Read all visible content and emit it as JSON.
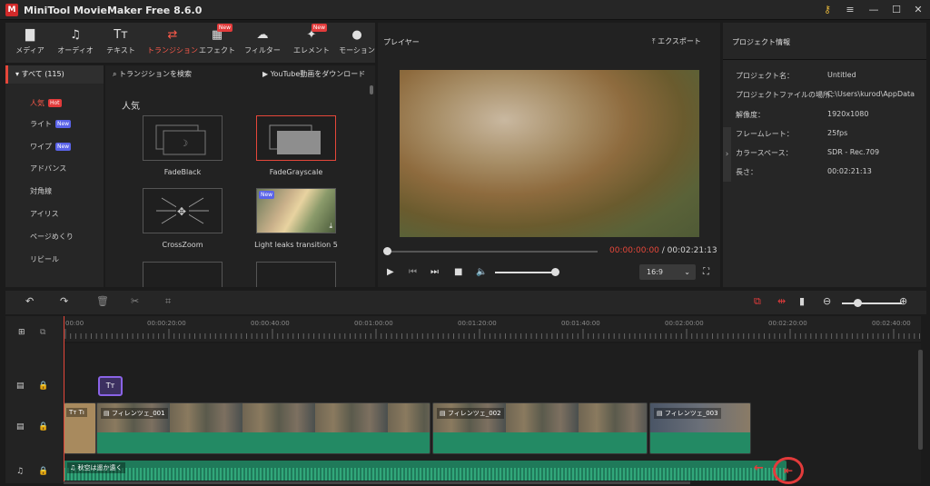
{
  "app": {
    "logo": "M",
    "title": "MiniTool MovieMaker Free 8.6.0"
  },
  "window_icons": [
    "key-icon",
    "menu-icon",
    "minimize-icon",
    "maximize-icon",
    "close-icon"
  ],
  "toolbar": [
    {
      "label": "メディア",
      "icon": "▇",
      "badge": ""
    },
    {
      "label": "オーディオ",
      "icon": "♫",
      "badge": ""
    },
    {
      "label": "テキスト",
      "icon": "Tт",
      "badge": ""
    },
    {
      "label": "トランジション",
      "icon": "⇄",
      "badge": ""
    },
    {
      "label": "エフェクト",
      "icon": "▦",
      "badge": "New"
    },
    {
      "label": "フィルター",
      "icon": "☁",
      "badge": ""
    },
    {
      "label": "エレメント",
      "icon": "✦",
      "badge": "New"
    },
    {
      "label": "モーション",
      "icon": "●",
      "badge": ""
    }
  ],
  "categories": {
    "header": "▾  すべて (115)",
    "items": [
      {
        "label": "人気",
        "badge": "Hot"
      },
      {
        "label": "ライト",
        "badge": "New"
      },
      {
        "label": "ワイプ",
        "badge": "New"
      },
      {
        "label": "アドバンス",
        "badge": ""
      },
      {
        "label": "対角線",
        "badge": ""
      },
      {
        "label": "アイリス",
        "badge": ""
      },
      {
        "label": "ページめくり",
        "badge": ""
      },
      {
        "label": "リビール",
        "badge": ""
      }
    ]
  },
  "transitions": {
    "search_placeholder": "トランジションを検索",
    "youtube": "YouTube動画をダウンロード",
    "section": "人気",
    "items": [
      {
        "label": "FadeBlack"
      },
      {
        "label": "FadeGrayscale"
      },
      {
        "label": "CrossZoom"
      },
      {
        "label": "Light leaks transition 5"
      }
    ],
    "new_badge": "New"
  },
  "player": {
    "label": "プレイヤー",
    "export": "エクスポート",
    "current_time": "00:00:00:00",
    "total_time": " / 00:02:21:13",
    "ratio": "16:9",
    "progress": 0.0,
    "volume": 0.9
  },
  "project": {
    "title": "プロジェクト情報",
    "rows": [
      {
        "k": "プロジェクト名：",
        "v": "Untitled"
      },
      {
        "k": "プロジェクトファイルの場所：",
        "v": "C:\\Users\\kurod\\AppData"
      },
      {
        "k": "解像度：",
        "v": "1920x1080"
      },
      {
        "k": "フレームレート：",
        "v": "25fps"
      },
      {
        "k": "カラースペース：",
        "v": "SDR - Rec.709"
      },
      {
        "k": "長さ：",
        "v": "00:02:21:13"
      }
    ]
  },
  "ruler": [
    "00:00",
    "00:00:20:00",
    "00:00:40:00",
    "00:01:00:00",
    "00:01:20:00",
    "00:01:40:00",
    "00:02:00:00",
    "00:02:20:00",
    "00:02:40:00"
  ],
  "timeline": {
    "text_clip": "Tт",
    "title_clip": "Tт  Tı",
    "clips": [
      "フィレンツェ_001",
      "フィレンツェ_002",
      "フィレンツェ_003"
    ],
    "audio": "♫ 秋空は遥か遠く",
    "zoom": 0.3
  }
}
